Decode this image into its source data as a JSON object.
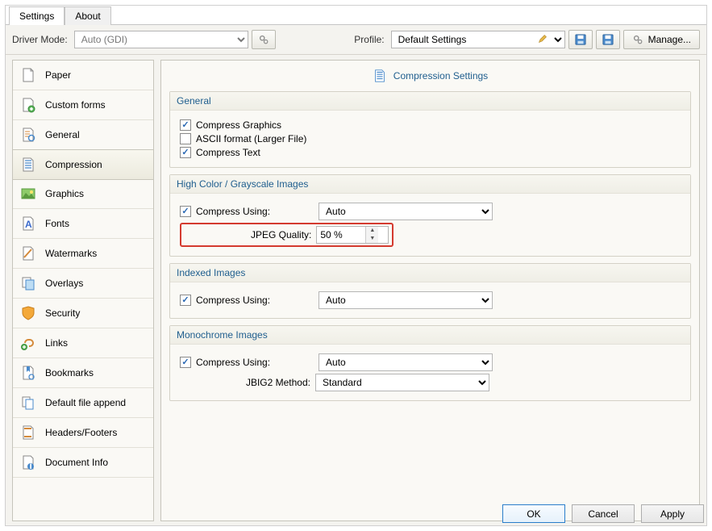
{
  "tabs": {
    "settings": "Settings",
    "about": "About"
  },
  "toolbar": {
    "driver_mode_label": "Driver Mode:",
    "driver_mode_value": "Auto (GDI)",
    "profile_label": "Profile:",
    "profile_value": "Default Settings",
    "manage_label": "Manage..."
  },
  "sidebar": {
    "items": [
      "Paper",
      "Custom forms",
      "General",
      "Compression",
      "Graphics",
      "Fonts",
      "Watermarks",
      "Overlays",
      "Security",
      "Links",
      "Bookmarks",
      "Default file append",
      "Headers/Footers",
      "Document Info"
    ],
    "selected_index": 3
  },
  "page": {
    "title": "Compression Settings",
    "groups": {
      "general": {
        "title": "General",
        "compress_graphics": "Compress Graphics",
        "ascii_format": "ASCII format (Larger File)",
        "compress_text": "Compress Text",
        "compress_graphics_checked": true,
        "ascii_format_checked": false,
        "compress_text_checked": true
      },
      "highcolor": {
        "title": "High Color / Grayscale Images",
        "compress_using_label": "Compress Using:",
        "compress_using_value": "Auto",
        "compress_using_checked": true,
        "jpeg_quality_label": "JPEG Quality:",
        "jpeg_quality_value": "50 %"
      },
      "indexed": {
        "title": "Indexed Images",
        "compress_using_label": "Compress Using:",
        "compress_using_value": "Auto",
        "compress_using_checked": true
      },
      "mono": {
        "title": "Monochrome Images",
        "compress_using_label": "Compress Using:",
        "compress_using_value": "Auto",
        "compress_using_checked": true,
        "jbig2_label": "JBIG2 Method:",
        "jbig2_value": "Standard"
      }
    }
  },
  "footer": {
    "ok": "OK",
    "cancel": "Cancel",
    "apply": "Apply"
  }
}
